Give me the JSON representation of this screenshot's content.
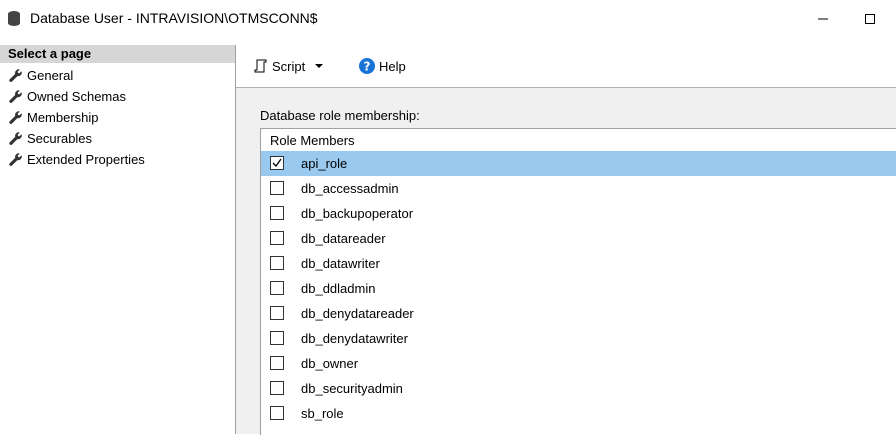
{
  "window": {
    "title": "Database User - INTRAVISION\\OTMSCONN$",
    "icon": "database-icon"
  },
  "left_pane": {
    "header": "Select a page",
    "items": [
      {
        "label": "General",
        "icon": "wrench-icon"
      },
      {
        "label": "Owned Schemas",
        "icon": "wrench-icon"
      },
      {
        "label": "Membership",
        "icon": "wrench-icon"
      },
      {
        "label": "Securables",
        "icon": "wrench-icon"
      },
      {
        "label": "Extended Properties",
        "icon": "wrench-icon"
      }
    ]
  },
  "toolbar": {
    "script_label": "Script",
    "help_label": "Help"
  },
  "membership": {
    "section_label": "Database role membership:",
    "column_header": "Role Members",
    "roles": [
      {
        "name": "api_role",
        "checked": true,
        "selected": true
      },
      {
        "name": "db_accessadmin",
        "checked": false,
        "selected": false
      },
      {
        "name": "db_backupoperator",
        "checked": false,
        "selected": false
      },
      {
        "name": "db_datareader",
        "checked": false,
        "selected": false
      },
      {
        "name": "db_datawriter",
        "checked": false,
        "selected": false
      },
      {
        "name": "db_ddladmin",
        "checked": false,
        "selected": false
      },
      {
        "name": "db_denydatareader",
        "checked": false,
        "selected": false
      },
      {
        "name": "db_denydatawriter",
        "checked": false,
        "selected": false
      },
      {
        "name": "db_owner",
        "checked": false,
        "selected": false
      },
      {
        "name": "db_securityadmin",
        "checked": false,
        "selected": false
      },
      {
        "name": "sb_role",
        "checked": false,
        "selected": false
      }
    ]
  },
  "colors": {
    "selected_row": "#99c9ef",
    "header_bg": "#d6d6d6",
    "help_icon": "#1a73d6"
  }
}
